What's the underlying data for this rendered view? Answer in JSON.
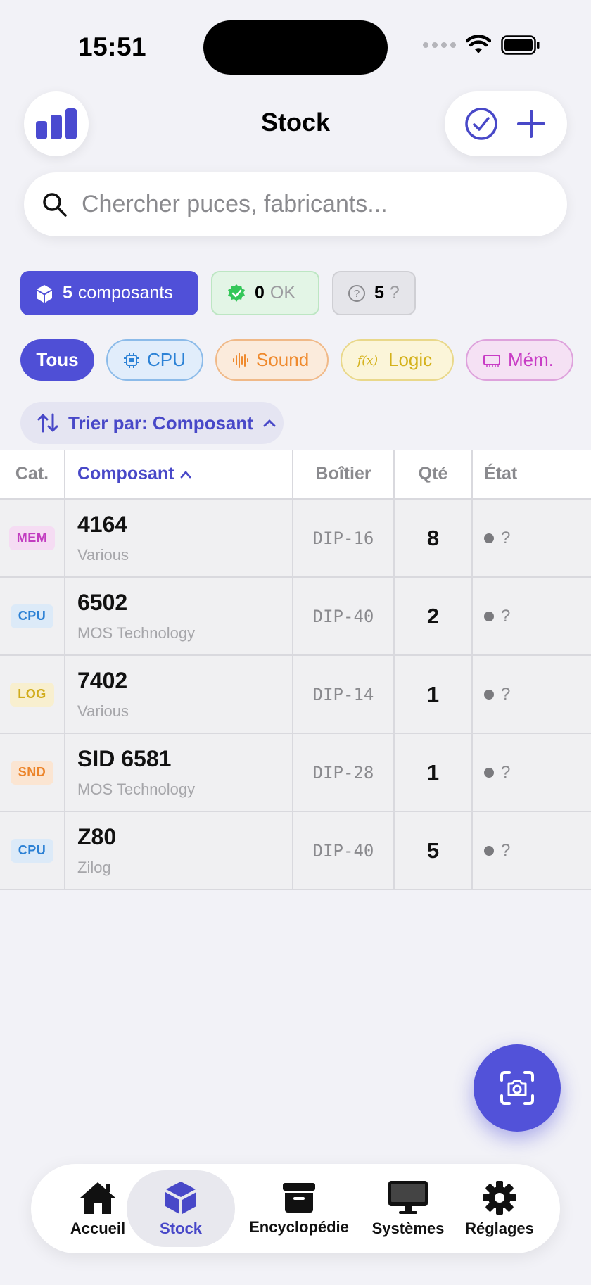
{
  "status": {
    "time": "15:51"
  },
  "header": {
    "title": "Stock"
  },
  "search": {
    "placeholder": "Chercher puces, fabricants..."
  },
  "stats": {
    "total_count": "5",
    "total_label": "composants",
    "ok_count": "0",
    "ok_label": "OK",
    "unknown_count": "5",
    "unknown_label": "?"
  },
  "filters": {
    "all": "Tous",
    "cpu": "CPU",
    "sound": "Sound",
    "logic": "Logic",
    "mem": "Mém."
  },
  "sort": {
    "label": "Trier par: Composant"
  },
  "table": {
    "headers": {
      "cat": "Cat.",
      "comp": "Composant",
      "box": "Boîtier",
      "qty": "Qté",
      "state": "État"
    },
    "rows": [
      {
        "cat": "MEM",
        "name": "4164",
        "mfr": "Various",
        "pkg": "DIP-16",
        "qty": "8",
        "state": "?"
      },
      {
        "cat": "CPU",
        "name": "6502",
        "mfr": "MOS Technology",
        "pkg": "DIP-40",
        "qty": "2",
        "state": "?"
      },
      {
        "cat": "LOG",
        "name": "7402",
        "mfr": "Various",
        "pkg": "DIP-14",
        "qty": "1",
        "state": "?"
      },
      {
        "cat": "SND",
        "name": "SID 6581",
        "mfr": "MOS Technology",
        "pkg": "DIP-28",
        "qty": "1",
        "state": "?"
      },
      {
        "cat": "CPU",
        "name": "Z80",
        "mfr": "Zilog",
        "pkg": "DIP-40",
        "qty": "5",
        "state": "?"
      }
    ]
  },
  "tabs": {
    "home": "Accueil",
    "stock": "Stock",
    "encyclopedia": "Encyclopédie",
    "systems": "Systèmes",
    "settings": "Réglages"
  },
  "colors": {
    "accent": "#5050d8",
    "background": "#f2f2f7"
  }
}
